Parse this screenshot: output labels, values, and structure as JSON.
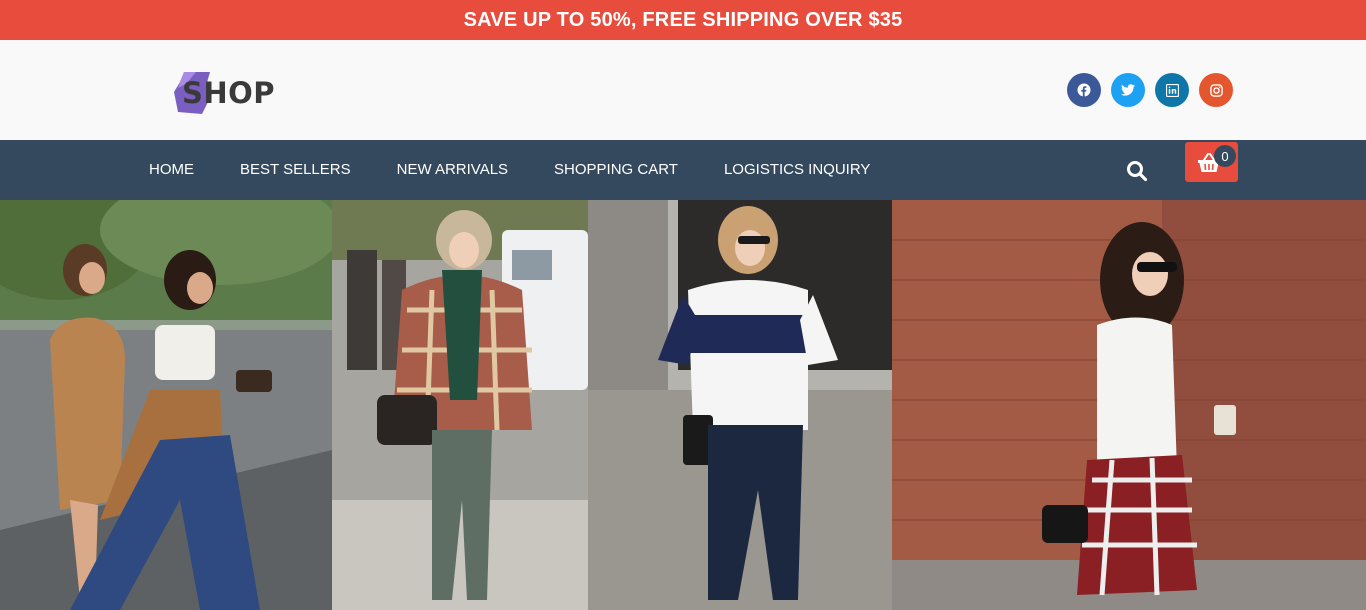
{
  "promo": {
    "text": "SAVE UP TO 50%, FREE SHIPPING OVER $35"
  },
  "logo": {
    "text": "SHOP",
    "mark_color": "#7b5fc0"
  },
  "socials": [
    {
      "name": "facebook",
      "color": "#3b5998"
    },
    {
      "name": "twitter",
      "color": "#1da1f2"
    },
    {
      "name": "linkedin",
      "color": "#0e76a8"
    },
    {
      "name": "instagram",
      "color": "#e4572e"
    }
  ],
  "nav": {
    "items": [
      {
        "label": "HOME"
      },
      {
        "label": "BEST SELLERS"
      },
      {
        "label": "NEW ARRIVALS"
      },
      {
        "label": "SHOPPING CART"
      },
      {
        "label": "LOGISTICS INQUIRY"
      }
    ],
    "cart_count": "0"
  },
  "hero": {
    "panels": [
      {
        "description": "two-women-street-photo"
      },
      {
        "description": "woman-plaid-poncho-photo"
      },
      {
        "description": "woman-striped-top-photo"
      },
      {
        "description": "woman-plaid-skirt-photo"
      }
    ]
  },
  "colors": {
    "accent": "#e74c3c",
    "nav_bg": "#34495e",
    "header_bg": "#f9f9f9"
  }
}
